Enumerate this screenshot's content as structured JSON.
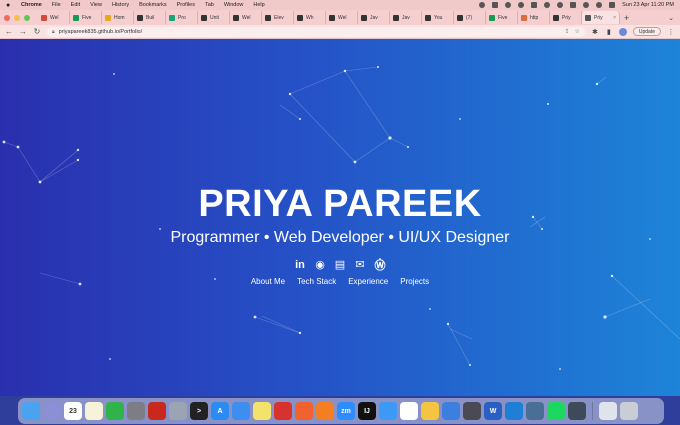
{
  "menubar": {
    "app": "Chrome",
    "items": [
      "File",
      "Edit",
      "View",
      "History",
      "Bookmarks",
      "Profiles",
      "Tab",
      "Window",
      "Help"
    ],
    "datetime": "Sun 23 Apr  11:20 PM"
  },
  "tabs": [
    {
      "label": "Wel",
      "color": "#d24b3c"
    },
    {
      "label": "Five",
      "color": "#1a9a55"
    },
    {
      "label": "Hom",
      "color": "#e6a91e"
    },
    {
      "label": "Buil",
      "color": "#333333"
    },
    {
      "label": "Pro",
      "color": "#18a37b"
    },
    {
      "label": "Unti",
      "color": "#333333"
    },
    {
      "label": "Wel",
      "color": "#333333"
    },
    {
      "label": "Elev",
      "color": "#333333"
    },
    {
      "label": "Wh",
      "color": "#333333"
    },
    {
      "label": "Wel",
      "color": "#333333"
    },
    {
      "label": "Jav",
      "color": "#333333"
    },
    {
      "label": "Jav",
      "color": "#333333"
    },
    {
      "label": "You",
      "color": "#333333"
    },
    {
      "label": "(7)",
      "color": "#333333"
    },
    {
      "label": "Five",
      "color": "#1a9a55"
    },
    {
      "label": "http",
      "color": "#e06a3a"
    },
    {
      "label": "Priy",
      "color": "#333333"
    },
    {
      "label": "Priy",
      "color": "#555555",
      "active": true
    }
  ],
  "toolbar": {
    "url": "priyapareek835.github.io/Portfolio/",
    "update_label": "Update"
  },
  "hero": {
    "name": "PRIYA PAREEK",
    "subtitle": "Programmer • Web Developer • UI/UX Designer",
    "socials": [
      {
        "icon": "linkedin-icon",
        "glyph": "in"
      },
      {
        "icon": "github-icon",
        "glyph": "◉"
      },
      {
        "icon": "pdf-icon",
        "glyph": "▤"
      },
      {
        "icon": "mail-icon",
        "glyph": "✉"
      },
      {
        "icon": "wordpress-icon",
        "glyph": "Ⓦ"
      }
    ],
    "links": [
      "About Me",
      "Tech Stack",
      "Experience",
      "Projects"
    ]
  },
  "dock": {
    "apps": [
      {
        "name": "finder",
        "color": "#4aa3f0",
        "glyph": ""
      },
      {
        "name": "launchpad",
        "color": "#8a8fd6",
        "glyph": ""
      },
      {
        "name": "calendar",
        "color": "#ffffff",
        "glyph": "23"
      },
      {
        "name": "notes",
        "color": "#f7f3d8",
        "glyph": ""
      },
      {
        "name": "numbers",
        "color": "#2fb34a",
        "glyph": ""
      },
      {
        "name": "settings",
        "color": "#7d7d85",
        "glyph": ""
      },
      {
        "name": "ruby",
        "color": "#c8281e",
        "glyph": ""
      },
      {
        "name": "preview",
        "color": "#9aa4b2",
        "glyph": ""
      },
      {
        "name": "terminal",
        "color": "#222222",
        "glyph": ">"
      },
      {
        "name": "app-store",
        "color": "#2a8bf2",
        "glyph": "A"
      },
      {
        "name": "mail",
        "color": "#3d8ef0",
        "glyph": ""
      },
      {
        "name": "stickies",
        "color": "#f3e36a",
        "glyph": ""
      },
      {
        "name": "creative-cloud",
        "color": "#d8322f",
        "glyph": ""
      },
      {
        "name": "swift",
        "color": "#f2622f",
        "glyph": ""
      },
      {
        "name": "firefox",
        "color": "#f57d22",
        "glyph": ""
      },
      {
        "name": "zoom",
        "color": "#2d8cff",
        "glyph": "zm"
      },
      {
        "name": "intellij",
        "color": "#111111",
        "glyph": "IJ"
      },
      {
        "name": "safari",
        "color": "#3b9af5",
        "glyph": ""
      },
      {
        "name": "slack",
        "color": "#ffffff",
        "glyph": ""
      },
      {
        "name": "chrome",
        "color": "#f4c542",
        "glyph": ""
      },
      {
        "name": "xcode",
        "color": "#3c7fe0",
        "glyph": ""
      },
      {
        "name": "instruments",
        "color": "#4a4a55",
        "glyph": ""
      },
      {
        "name": "word",
        "color": "#2b5fc4",
        "glyph": "W"
      },
      {
        "name": "vscode",
        "color": "#1f7fd6",
        "glyph": ""
      },
      {
        "name": "screen",
        "color": "#4a6f96",
        "glyph": ""
      },
      {
        "name": "spotify",
        "color": "#1ed760",
        "glyph": ""
      },
      {
        "name": "quicktime",
        "color": "#3e4a5a",
        "glyph": ""
      },
      {
        "name": "downloads",
        "color": "#dfe3ea",
        "glyph": ""
      },
      {
        "name": "trash",
        "color": "#c9ced6",
        "glyph": ""
      }
    ]
  }
}
